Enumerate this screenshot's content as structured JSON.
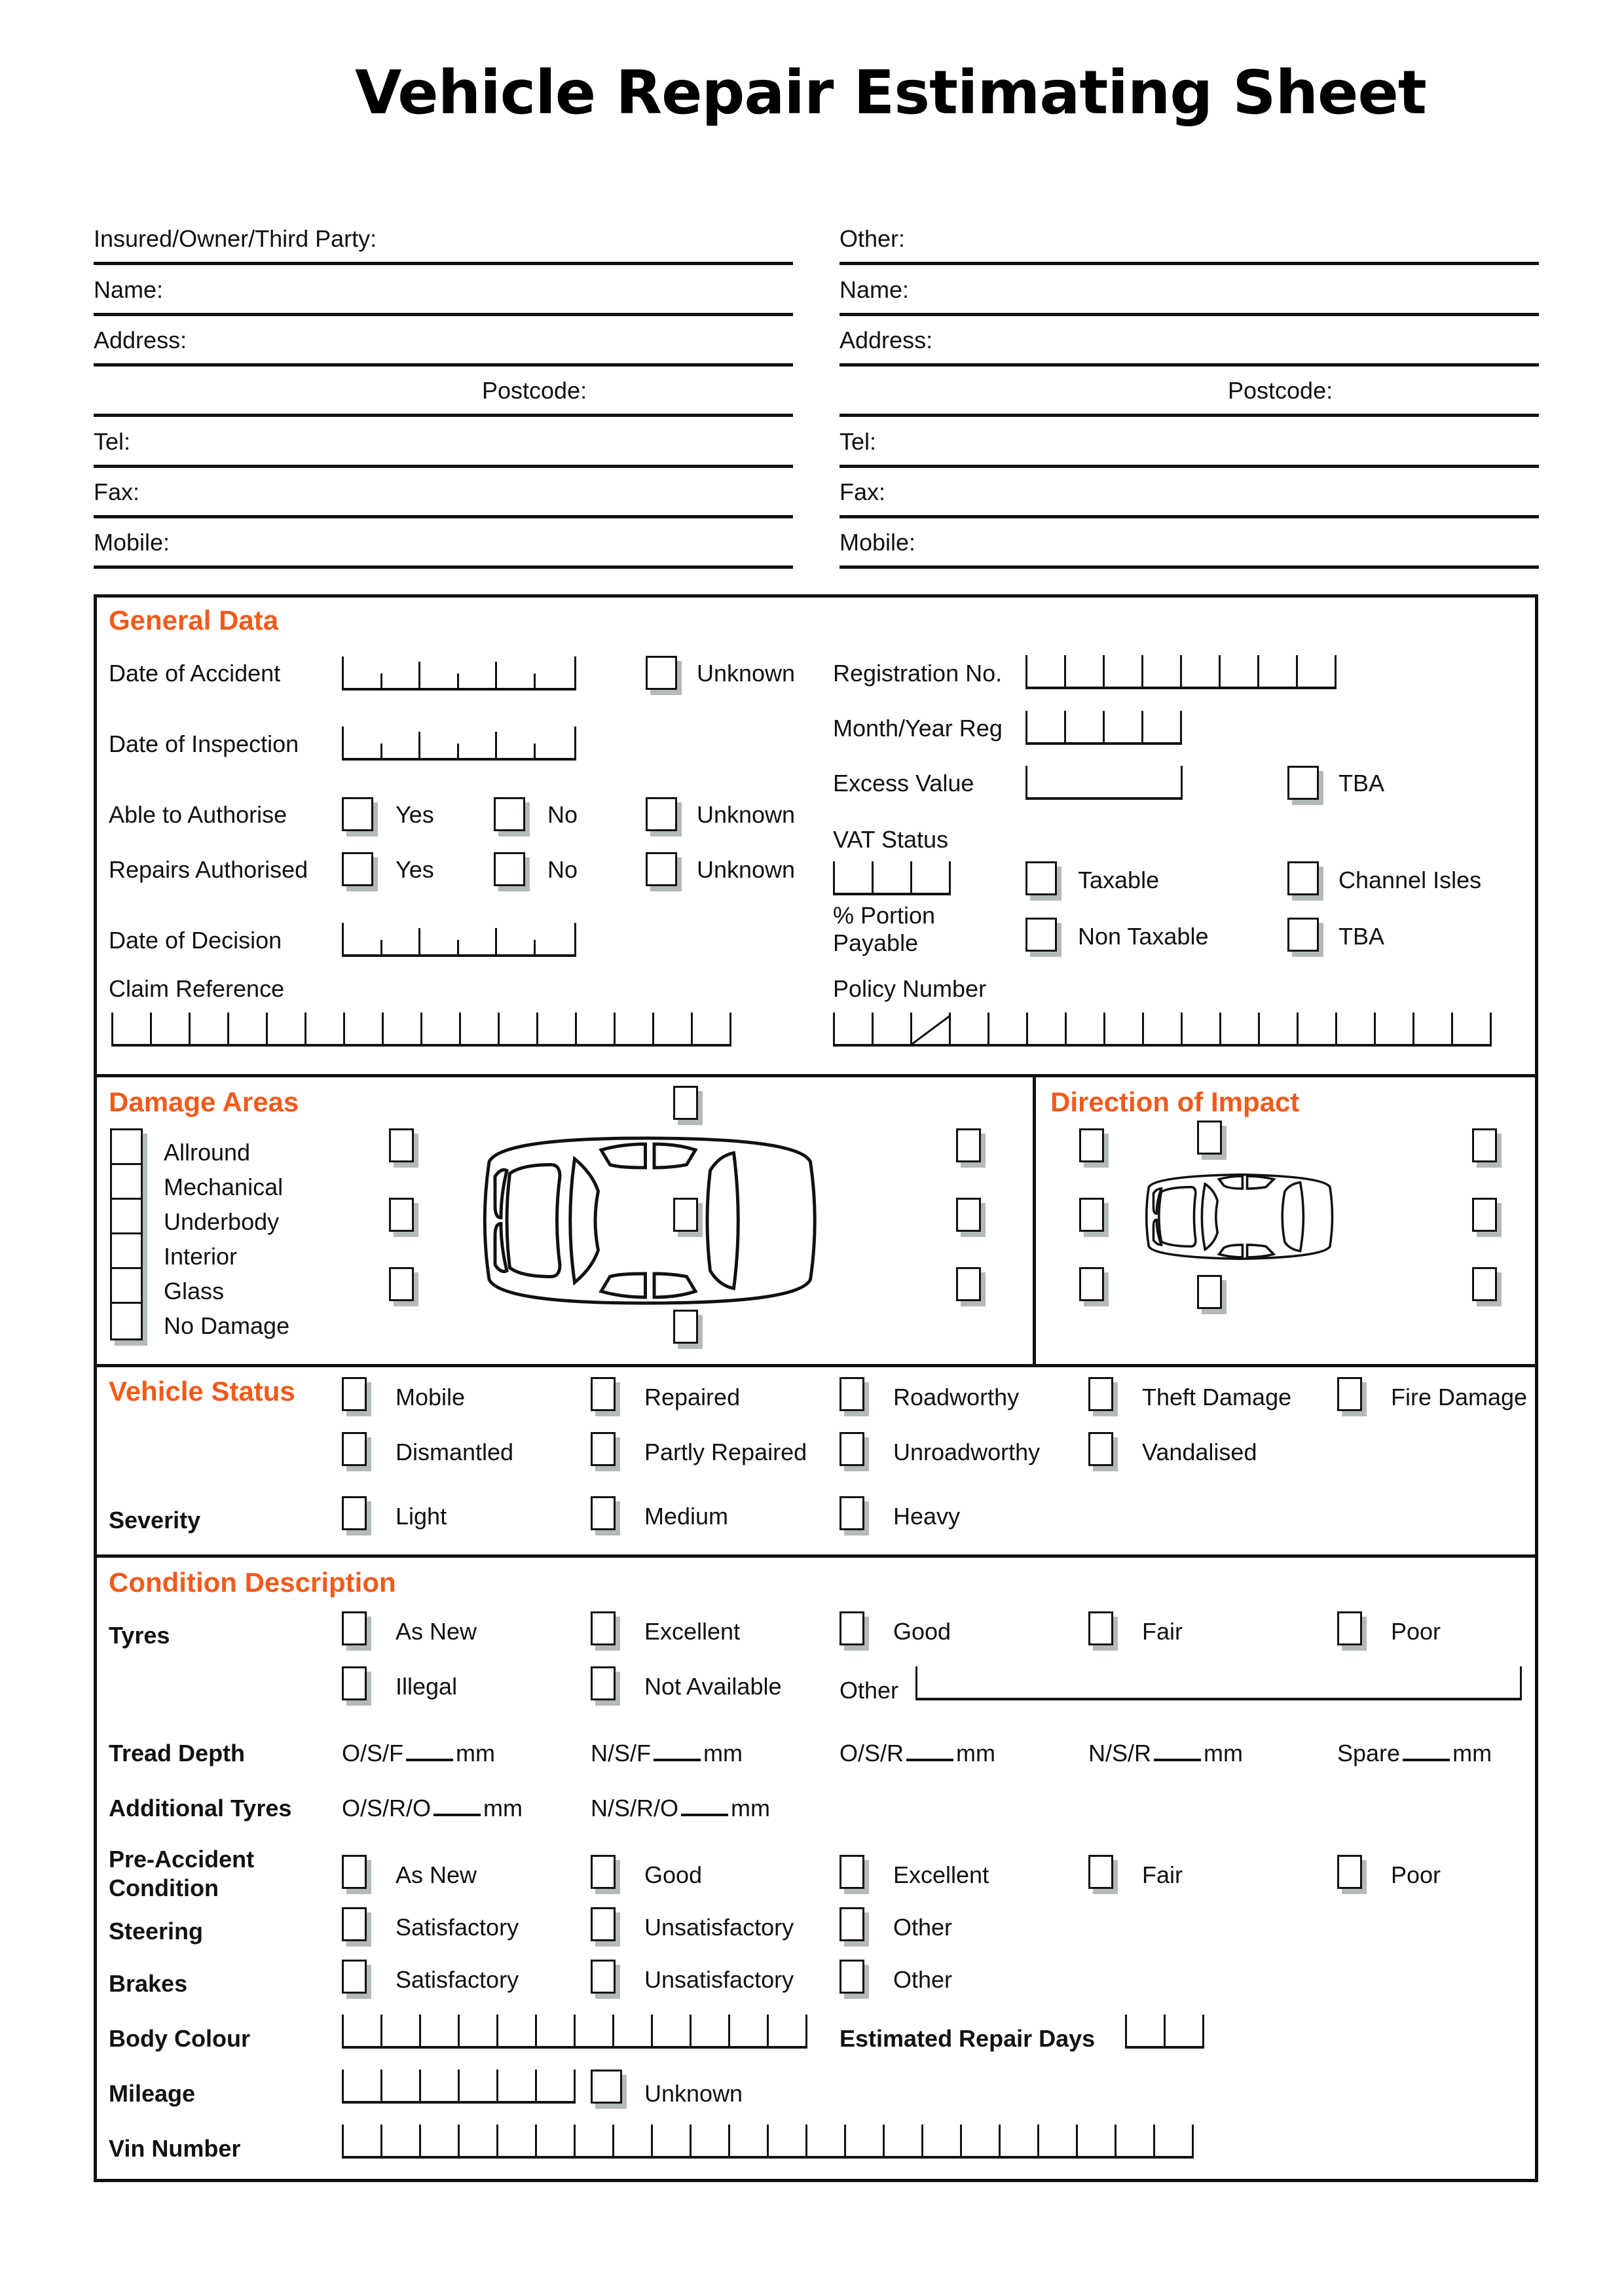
{
  "title": "Vehicle Repair Estimating Sheet",
  "colors": {
    "accent": "#F25A1A",
    "line": "#111111",
    "shadow": "#b4b9b9"
  },
  "contact": {
    "left": {
      "heading": "Insured/Owner/Third Party:",
      "name": "Name:",
      "address": "Address:",
      "postcode": "Postcode:",
      "tel": "Tel:",
      "fax": "Fax:",
      "mobile": "Mobile:"
    },
    "right": {
      "heading": "Other:",
      "name": "Name:",
      "address": "Address:",
      "postcode": "Postcode:",
      "tel": "Tel:",
      "fax": "Fax:",
      "mobile": "Mobile:"
    }
  },
  "general_data": {
    "title": "General Data",
    "date_of_accident": "Date of Accident",
    "date_of_inspection": "Date of Inspection",
    "able_to_authorise": "Able to Authorise",
    "repairs_authorised": "Repairs Authorised",
    "date_of_decision": "Date of Decision",
    "claim_reference": "Claim Reference",
    "unknown": "Unknown",
    "yes": "Yes",
    "no": "No",
    "registration_no": "Registration No.",
    "month_year_reg": "Month/Year Reg",
    "excess_value": "Excess Value",
    "tba": "TBA",
    "vat_status": "VAT Status",
    "taxable": "Taxable",
    "channel_isles": "Channel Isles",
    "portion_payable_1": "% Portion",
    "portion_payable_2": "Payable",
    "non_taxable": "Non Taxable",
    "policy_number": "Policy Number",
    "cells": {
      "registration": 8,
      "month_year": 4,
      "vat_percent": 3,
      "claim_reference": 16,
      "policy_number": 17
    }
  },
  "damage_areas": {
    "title": "Damage Areas",
    "items": [
      "Allround",
      "Mechanical",
      "Underbody",
      "Interior",
      "Glass",
      "No Damage"
    ]
  },
  "direction_of_impact": {
    "title": "Direction of Impact"
  },
  "vehicle_status": {
    "title": "Vehicle Status",
    "row1": [
      "Mobile",
      "Repaired",
      "Roadworthy",
      "Theft Damage",
      "Fire Damage"
    ],
    "row2": [
      "Dismantled",
      "Partly Repaired",
      "Unroadworthy",
      "Vandalised"
    ],
    "severity_label": "Severity",
    "severity": [
      "Light",
      "Medium",
      "Heavy"
    ]
  },
  "condition": {
    "title": "Condition Description",
    "tyres_label": "Tyres",
    "tyres_row1": [
      "As New",
      "Excellent",
      "Good",
      "Fair",
      "Poor"
    ],
    "tyres_row2": [
      "Illegal",
      "Not Available"
    ],
    "tyres_other": "Other",
    "tread_label": "Tread Depth",
    "tread": [
      {
        "pos": "O/S/F",
        "unit": "mm"
      },
      {
        "pos": "N/S/F",
        "unit": "mm"
      },
      {
        "pos": "O/S/R",
        "unit": "mm"
      },
      {
        "pos": "N/S/R",
        "unit": "mm"
      },
      {
        "pos": "Spare",
        "unit": "mm"
      }
    ],
    "additional_label": "Additional Tyres",
    "additional": [
      {
        "pos": "O/S/R/O",
        "unit": "mm"
      },
      {
        "pos": "N/S/R/O",
        "unit": "mm"
      }
    ],
    "pre_accident_label_1": "Pre-Accident",
    "pre_accident_label_2": "Condition",
    "pre_accident": [
      "As New",
      "Good",
      "Excellent",
      "Fair",
      "Poor"
    ],
    "steering_label": "Steering",
    "steering": [
      "Satisfactory",
      "Unsatisfactory",
      "Other"
    ],
    "brakes_label": "Brakes",
    "brakes": [
      "Satisfactory",
      "Unsatisfactory",
      "Other"
    ],
    "body_colour_label": "Body Colour",
    "estimated_repair_days_label": "Estimated Repair Days",
    "mileage_label": "Mileage",
    "mileage_unknown": "Unknown",
    "vin_label": "Vin Number",
    "cells": {
      "body_colour": 12,
      "repair_days": 2,
      "mileage": 6,
      "vin": 22
    }
  }
}
